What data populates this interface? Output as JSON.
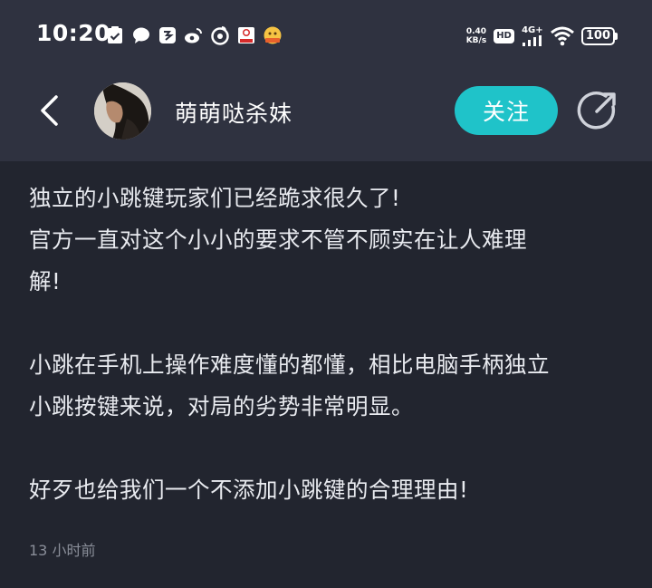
{
  "status_bar": {
    "time": "10:20",
    "net_speed_value": "0.40",
    "net_speed_unit": "KB/s",
    "hd_label": "HD",
    "signal_label": "4G+",
    "battery": "100"
  },
  "header": {
    "username": "萌萌哒杀妹",
    "follow_label": "关注"
  },
  "post": {
    "paragraphs": [
      {
        "lines": [
          "独立的小跳键玩家们已经跪求很久了!",
          "官方一直对这个小小的要求不管不顾实在让人难理",
          "解!"
        ]
      },
      {
        "lines": [
          "小跳在手机上操作难度懂的都懂，相比电脑手柄独立",
          "小跳按键来说，对局的劣势非常明显。"
        ]
      },
      {
        "lines": [
          "好歹也给我们一个不添加小跳键的合理理由!"
        ]
      }
    ],
    "timestamp": "13 小时前"
  },
  "colors": {
    "header_bg": "#2f3240",
    "page_bg": "#22252f",
    "accent": "#1fc3c9"
  },
  "icons": [
    "check-icon",
    "chat-icon",
    "vpn-icon",
    "weibo-icon",
    "netease-icon",
    "kfc-icon",
    "game-icon",
    "wifi-icon",
    "back-arrow-icon",
    "share-icon"
  ]
}
